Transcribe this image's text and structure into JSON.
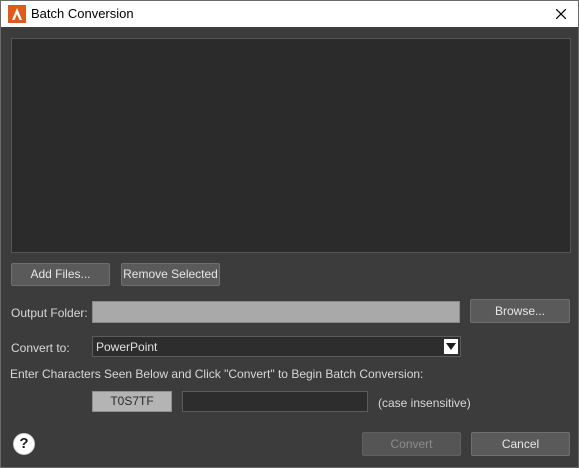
{
  "window": {
    "title": "Batch Conversion"
  },
  "icons": {
    "app": "app-logo-icon",
    "close": "close-icon",
    "dropdown": "chevron-down-icon",
    "help": "help-icon"
  },
  "colors": {
    "background": "#3c3c3c",
    "accent": "#e05a1b"
  },
  "file_actions": {
    "add_label": "Add Files...",
    "remove_label": "Remove Selected"
  },
  "output": {
    "label": "Output Folder:",
    "value": "",
    "browse_label": "Browse..."
  },
  "convert_to": {
    "label": "Convert to:",
    "selected": "PowerPoint"
  },
  "captcha": {
    "instructions": "Enter Characters Seen Below and Click \"Convert\" to Begin Batch Conversion:",
    "code": "T0S7TF",
    "input_value": "",
    "hint": "(case insensitive)"
  },
  "footer": {
    "help_label": "?",
    "convert_label": "Convert",
    "cancel_label": "Cancel"
  }
}
